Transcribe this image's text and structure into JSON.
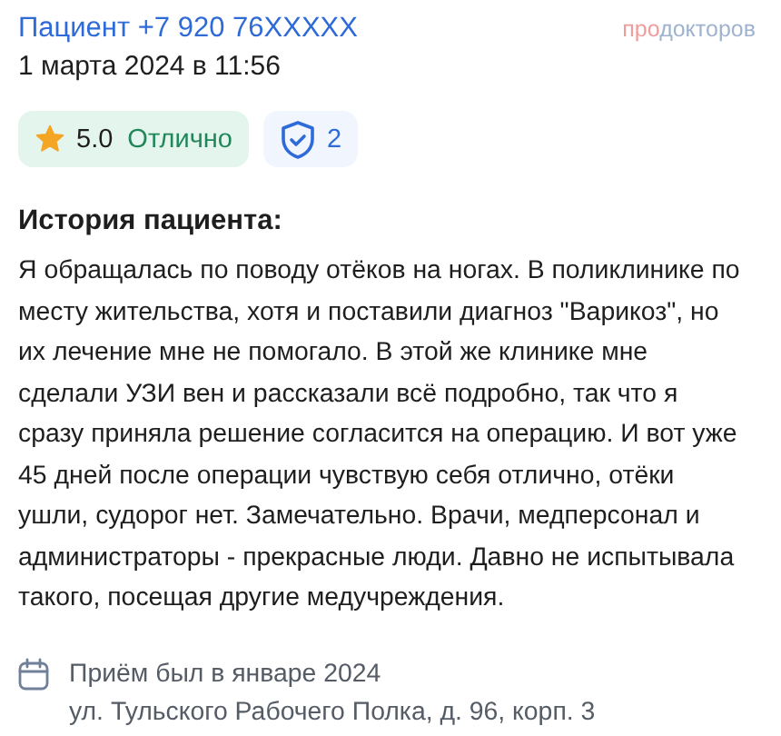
{
  "author": "Пациент +7 920 76XXXXX",
  "date": "1 марта 2024 в 11:56",
  "logo": {
    "prefix": "про",
    "rest": "докторов"
  },
  "rating": {
    "value": "5.0",
    "label": "Отлично"
  },
  "verified": {
    "count": "2"
  },
  "history": {
    "title": "История пациента:",
    "text": "Я обращалась по поводу отёков на ногах. В поликлинике по месту жительства, хотя и поставили диагноз \"Варикоз\", но их лечение мне не помогало. В этой же клинике мне сделали УЗИ вен и рассказали всё подробно, так что я сразу приняла решение согласится на операцию. И вот уже 45 дней после операции чувствую себя отлично, отёки ушли, судорог нет. Замечательно. Врачи, медперсонал и администраторы - прекрасные люди. Давно не испытывала такого, посещая другие медучреждения."
  },
  "visit": {
    "when": "Приём был в январе 2024",
    "address": "ул. Тульского Рабочего Полка, д. 96, корп. 3"
  }
}
